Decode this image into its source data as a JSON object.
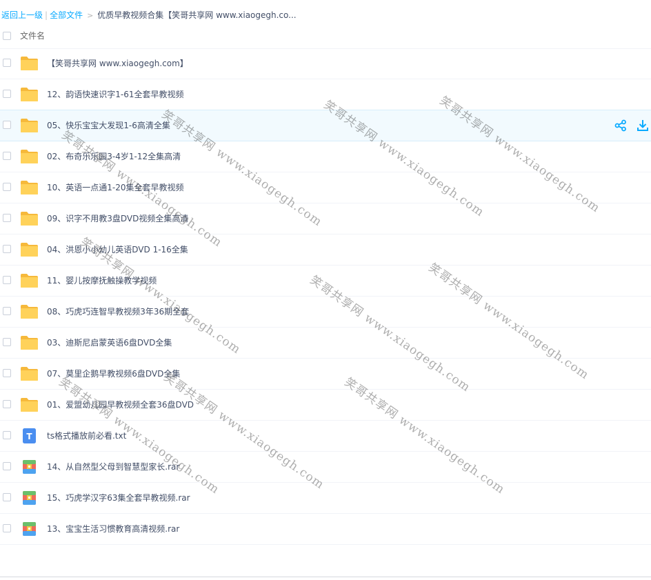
{
  "breadcrumb": {
    "back": "返回上一级",
    "separator": "|",
    "all_files": "全部文件",
    "arrow": ">",
    "current": "优质早教视频合集【笑哥共享网 www.xiaogegh.co..."
  },
  "list_header": {
    "label": "文件名"
  },
  "files": [
    {
      "name": "【笑哥共享网 www.xiaogegh.com】",
      "type": "folder"
    },
    {
      "name": "12、韵语快速识字1-61全套早教视频",
      "type": "folder"
    },
    {
      "name": "05、快乐宝宝大发现1-6高清全集",
      "type": "folder",
      "hover": true
    },
    {
      "name": "02、布奇乐乐园3-4岁1-12全集高清",
      "type": "folder"
    },
    {
      "name": "10、英语一点通1-20集全套早教视频",
      "type": "folder"
    },
    {
      "name": "09、识字不用教3盘DVD视频全集高清",
      "type": "folder"
    },
    {
      "name": "04、洪恩小小幼儿英语DVD 1-16全集",
      "type": "folder"
    },
    {
      "name": "11、婴儿按摩抚触操教学视频",
      "type": "folder"
    },
    {
      "name": "08、巧虎巧连智早教视频3年36期全套",
      "type": "folder"
    },
    {
      "name": "03、迪斯尼启蒙英语6盘DVD全集",
      "type": "folder"
    },
    {
      "name": "07、莫里企鹅早教视频6盘DVD全集",
      "type": "folder"
    },
    {
      "name": "01、爱盟幼儿园早教视频全套36盘DVD",
      "type": "folder"
    },
    {
      "name": "ts格式播放前必看.txt",
      "type": "txt"
    },
    {
      "name": "14、从自然型父母到智慧型家长.rar",
      "type": "rar"
    },
    {
      "name": "15、巧虎学汉字63集全套早教视频.rar",
      "type": "rar"
    },
    {
      "name": "13、宝宝生活习惯教育高清视频.rar",
      "type": "rar"
    }
  ],
  "row_actions": {
    "share_icon": "share-icon",
    "download_icon": "download-icon"
  },
  "watermark": {
    "text": "笑哥共享网 www.xiaogegh.com"
  },
  "colors": {
    "link": "#09aaff",
    "folder": "#ffd25a",
    "txt_icon": "#4a8ef0",
    "hover_row": "#f2fafe",
    "action_icon": "#09aaff"
  }
}
